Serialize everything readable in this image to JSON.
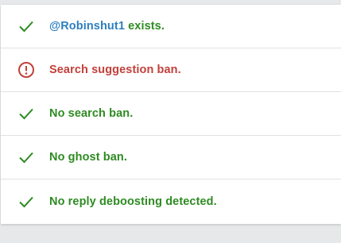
{
  "results": [
    {
      "status": "ok",
      "icon": "checkmark-icon",
      "handle": "@Robinshut1",
      "text": " exists."
    },
    {
      "status": "warn",
      "icon": "exclamation-circle-icon",
      "text": "Search suggestion ban."
    },
    {
      "status": "ok",
      "icon": "checkmark-icon",
      "text": "No search ban."
    },
    {
      "status": "ok",
      "icon": "checkmark-icon",
      "text": "No ghost ban."
    },
    {
      "status": "ok",
      "icon": "checkmark-icon",
      "text": "No reply deboosting detected."
    }
  ],
  "colors": {
    "ok": "#2e8b22",
    "warn": "#c2403a",
    "link": "#2d7fc0",
    "background": "#e6e8ea",
    "card": "#ffffff"
  }
}
